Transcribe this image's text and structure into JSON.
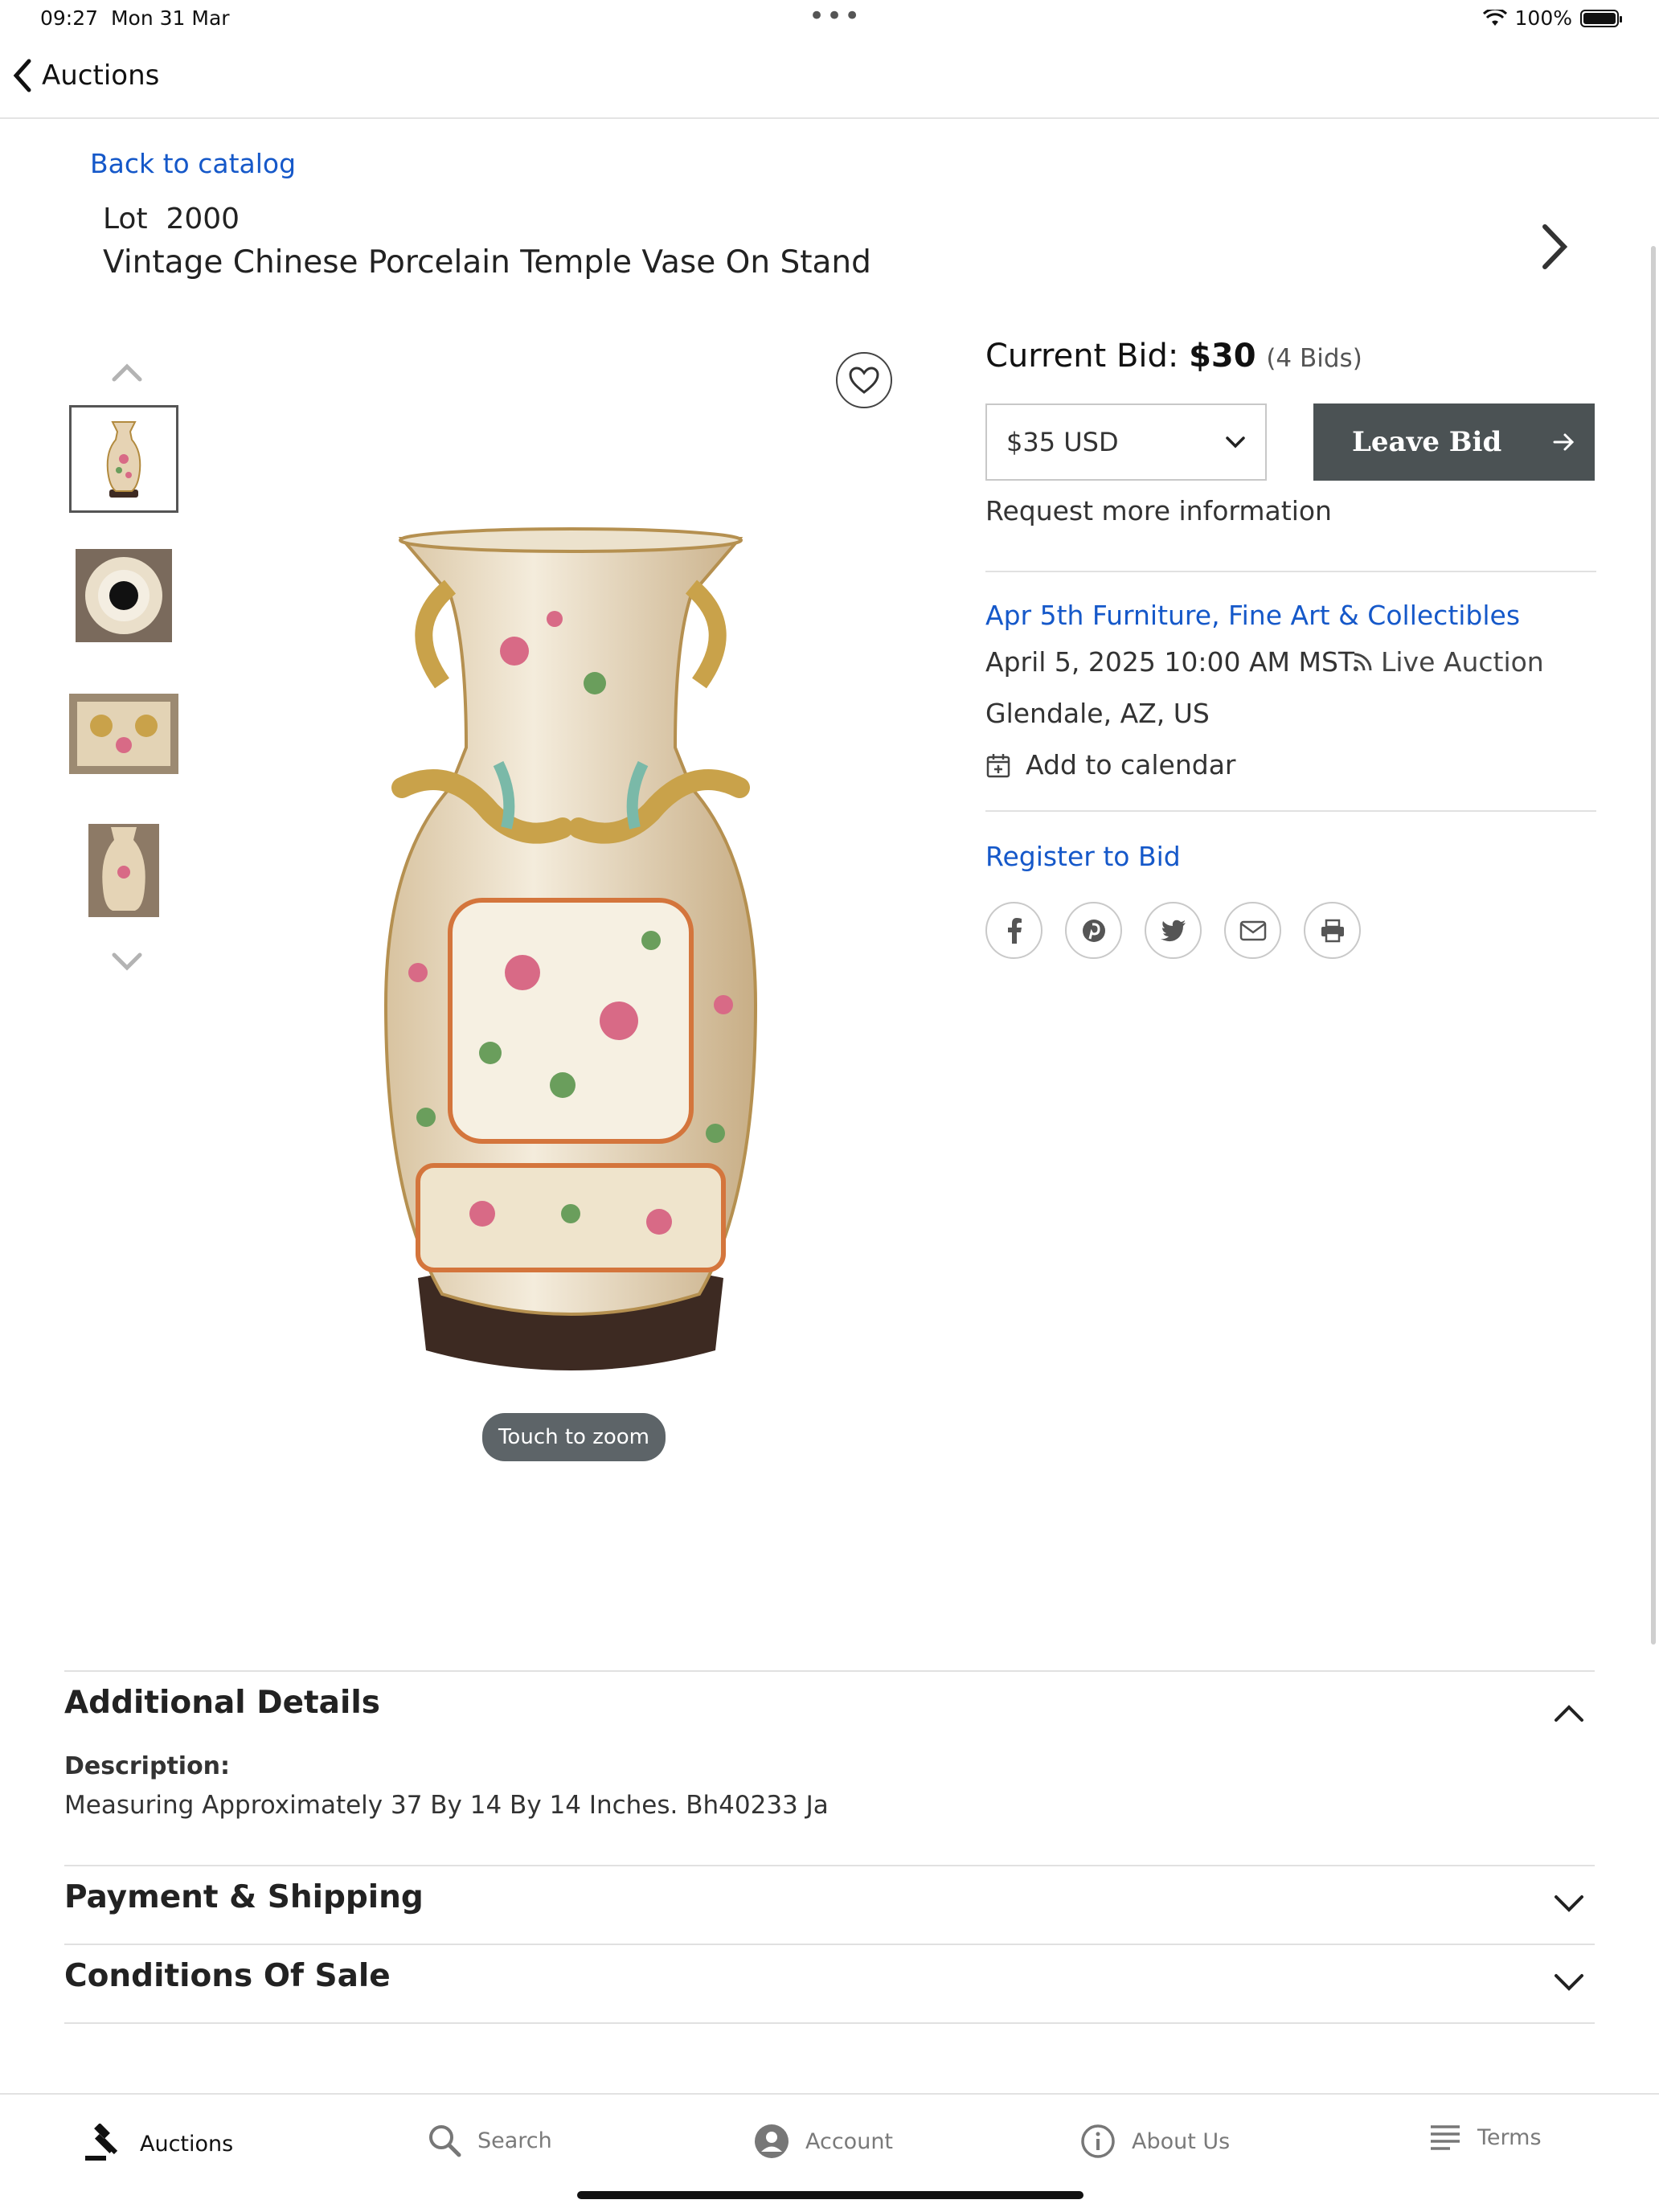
{
  "status": {
    "time": "09:27",
    "date": "Mon 31 Mar",
    "battery": "100%"
  },
  "nav": {
    "back_label": "Auctions"
  },
  "page": {
    "back_to_catalog": "Back to catalog",
    "lot_number": "Lot  2000",
    "lot_title": "Vintage Chinese Porcelain Temple Vase On Stand"
  },
  "viewer": {
    "zoom_hint": "Touch to zoom"
  },
  "bid": {
    "label": "Current Bid:",
    "amount": "$30",
    "count": "(4 Bids)",
    "select_value": "$35 USD",
    "leave_bid": "Leave Bid",
    "request_info": "Request more information"
  },
  "auction": {
    "name": "Apr 5th Furniture, Fine Art & Collectibles",
    "date": "April 5, 2025 10:00 AM MST",
    "type": "Live Auction",
    "location": "Glendale, AZ, US",
    "add_calendar": "Add to calendar",
    "register": "Register to Bid"
  },
  "share_icons": [
    "facebook-icon",
    "pinterest-icon",
    "twitter-icon",
    "email-icon",
    "print-icon"
  ],
  "details": {
    "additional_title": "Additional Details",
    "description_label": "Description:",
    "description_text": "Measuring Approximately 37 By 14 By 14 Inches. Bh40233 Ja",
    "payment_title": "Payment & Shipping",
    "conditions_title": "Conditions Of Sale"
  },
  "tabs": [
    {
      "label": "Auctions",
      "icon": "gavel-icon",
      "active": true
    },
    {
      "label": "Search",
      "icon": "search-icon",
      "active": false
    },
    {
      "label": "Account",
      "icon": "account-icon",
      "active": false
    },
    {
      "label": "About Us",
      "icon": "info-icon",
      "active": false
    },
    {
      "label": "Terms",
      "icon": "list-icon",
      "active": false
    }
  ],
  "colors": {
    "link": "#1558c9",
    "button": "#4b5254"
  }
}
